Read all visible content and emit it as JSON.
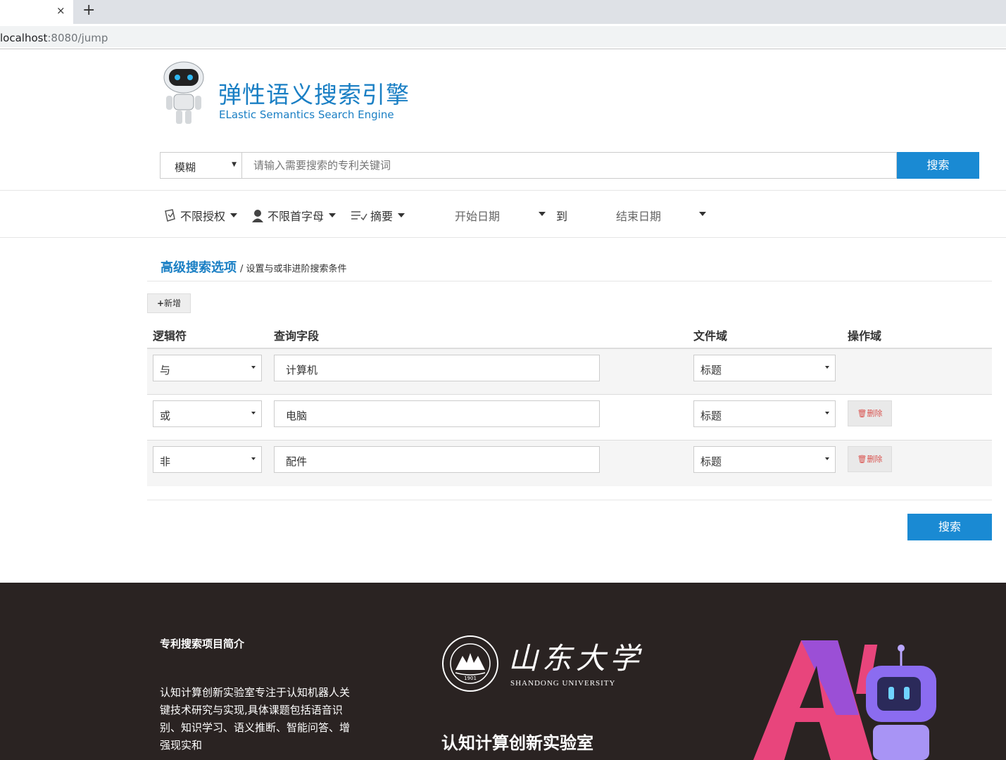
{
  "browser": {
    "close_glyph": "×",
    "newtab_glyph": "+",
    "url_host": "localhost",
    "url_rest": ":8080/jump"
  },
  "header": {
    "title": "弹性语义搜索引擎",
    "subtitle": "ELastic Semantics Search Engine"
  },
  "search": {
    "mode": "模糊",
    "placeholder": "请输入需要搜索的专利关键词",
    "button": "搜索"
  },
  "filters": {
    "auth": "不限授权",
    "letter": "不限首字母",
    "summary": "摘要",
    "start_date": "开始日期",
    "to": "到",
    "end_date": "结束日期"
  },
  "advanced": {
    "title": "高级搜索选项",
    "separator": "/",
    "subtitle": "设置与或非进阶搜索条件",
    "add_button": "新增",
    "headers": [
      "逻辑符",
      "查询字段",
      "文件域",
      "操作域"
    ],
    "rows": [
      {
        "logic": "与",
        "field": "计算机",
        "domain": "标题",
        "action": ""
      },
      {
        "logic": "或",
        "field": "电脑",
        "domain": "标题",
        "action": "删除"
      },
      {
        "logic": "非",
        "field": "配件",
        "domain": "标题",
        "action": "删除"
      }
    ],
    "search_button": "搜索"
  },
  "footer": {
    "title": "专利搜索项目简介",
    "text": "认知计算创新实验室专注于认知机器人关键技术研究与实现,具体课题包括语音识别、知识学习、语义推断、智能问答、增强现实和",
    "university_cn": "山东大学",
    "university_en": "SHANDONG UNIVERSITY",
    "seal_year": "1901",
    "lab_name": "认知计算创新实验室"
  },
  "colors": {
    "brand_blue": "#1a8ad3",
    "footer_bg": "#2a2322",
    "delete_red": "#d9534f"
  }
}
